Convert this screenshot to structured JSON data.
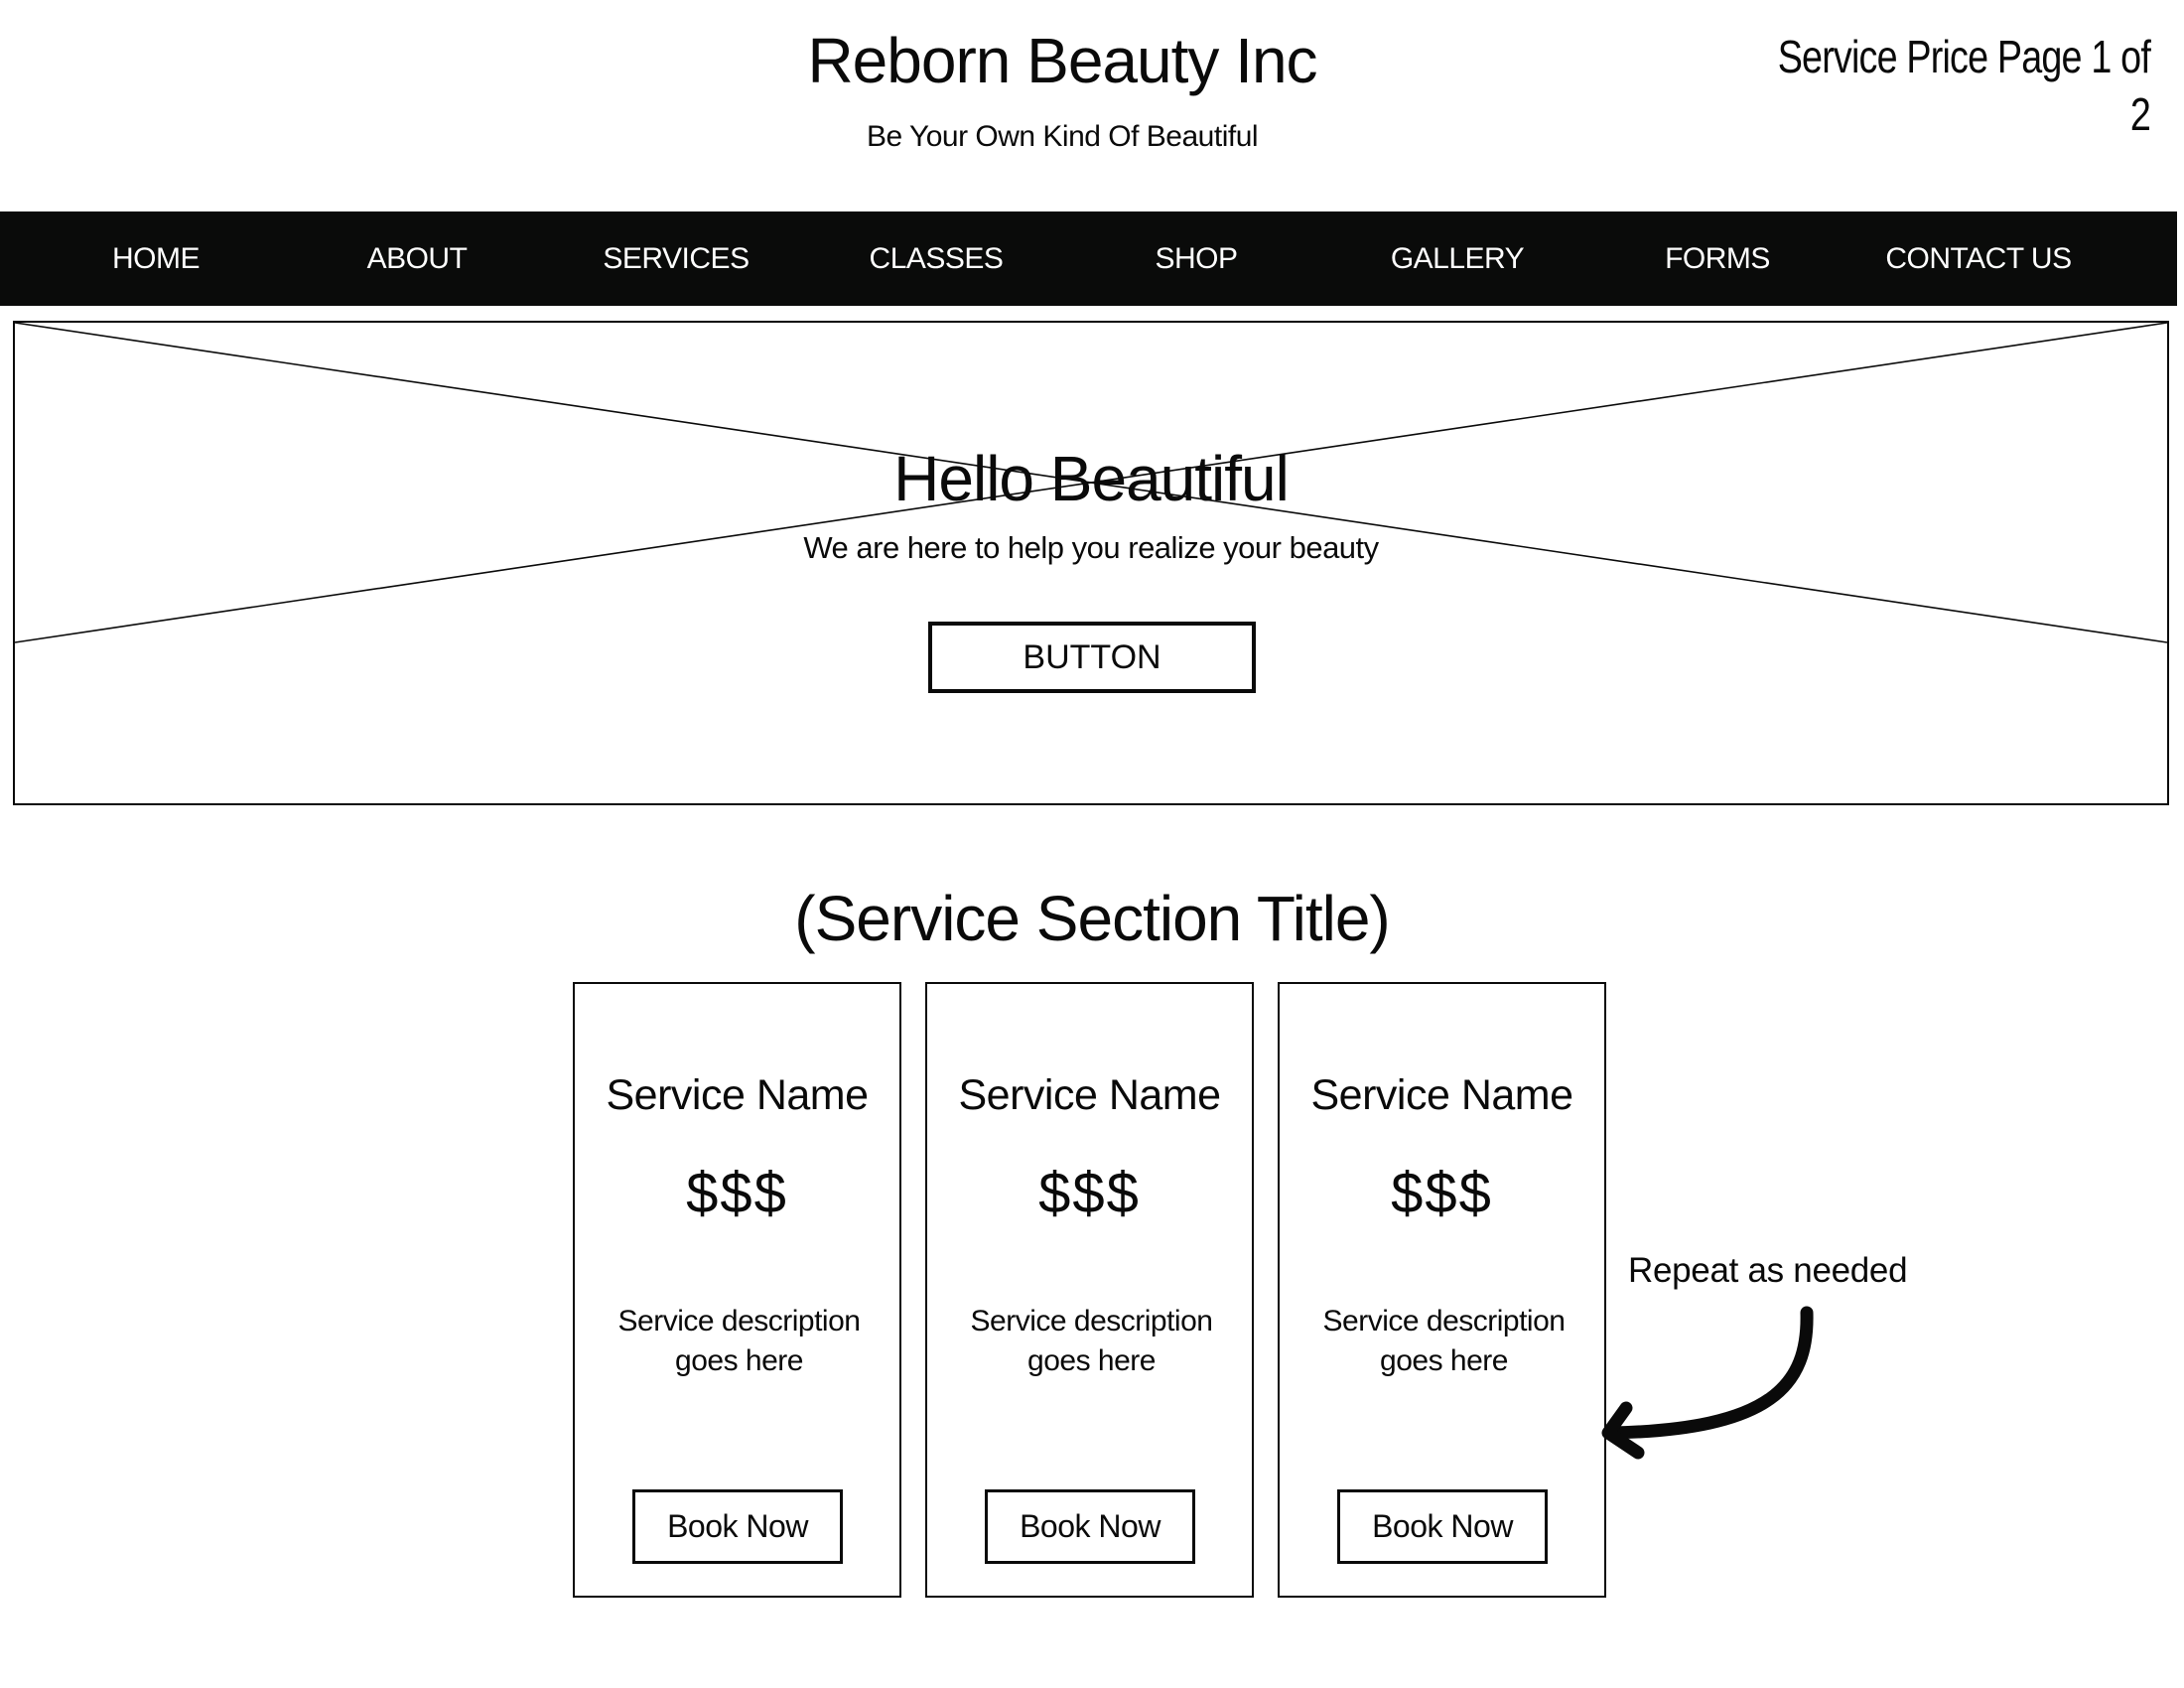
{
  "header": {
    "brand_title": "Reborn Beauty Inc",
    "tagline": "Be Your Own Kind Of Beautiful",
    "page_indicator": "Service Price Page 1 of 2"
  },
  "nav": {
    "items": [
      {
        "label": "HOME"
      },
      {
        "label": "ABOUT"
      },
      {
        "label": "SERVICES"
      },
      {
        "label": "CLASSES"
      },
      {
        "label": "SHOP"
      },
      {
        "label": "GALLERY"
      },
      {
        "label": "FORMS"
      },
      {
        "label": "CONTACT US"
      }
    ]
  },
  "hero": {
    "image_placeholder": "image-placeholder-icon",
    "title": "Hello Beautiful",
    "subtitle": "We are here to help you realize your beauty",
    "button_label": "BUTTON"
  },
  "services": {
    "section_title": "(Service Section Title)",
    "cards": [
      {
        "name": "Service Name",
        "price": "$$$",
        "description": "Service description goes here",
        "button_label": "Book Now"
      },
      {
        "name": "Service Name",
        "price": "$$$",
        "description": "Service description goes here",
        "button_label": "Book Now"
      },
      {
        "name": "Service Name",
        "price": "$$$",
        "description": "Service description goes here",
        "button_label": "Book Now"
      }
    ]
  },
  "annotation": {
    "text": "Repeat as needed",
    "icon": "curved-arrow-left-icon"
  },
  "colors": {
    "nav_background": "#0a0b0a",
    "nav_text": "#ffffff",
    "ink": "#0a0a0a",
    "page_background": "#ffffff"
  }
}
